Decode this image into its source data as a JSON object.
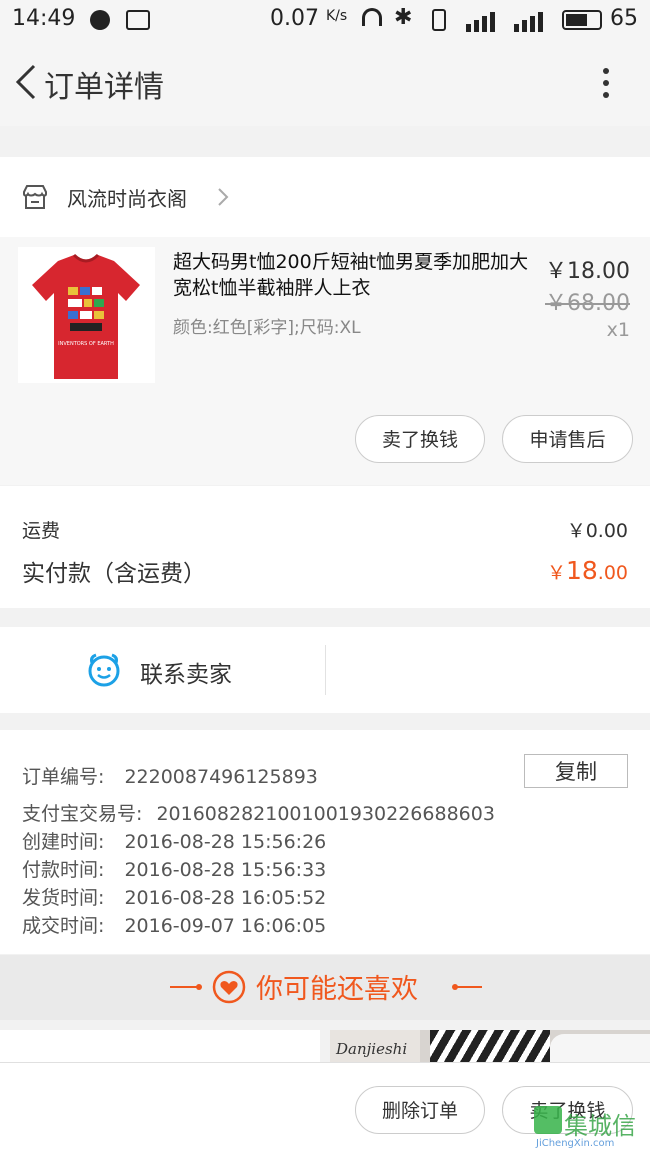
{
  "status_bar": {
    "time": "14:49",
    "net_speed": "0.07",
    "net_unit": "K/s",
    "battery": "65"
  },
  "app_bar": {
    "title": "订单详情"
  },
  "shop": {
    "name": "风流时尚衣阁"
  },
  "product": {
    "title": "超大码男t恤200斤短袖t恤男夏季加肥加大宽松t恤半截袖胖人上衣",
    "attributes": "颜色:红色[彩字];尺码:XL",
    "price": "￥18.00",
    "original_price": "￥68.00",
    "quantity": "x1",
    "image_caption": "INVENTORS OF EARTH"
  },
  "actions": {
    "sell": "卖了换钱",
    "after_sales": "申请售后"
  },
  "fees": {
    "shipping_label": "运费",
    "shipping_value": "￥0.00",
    "paid_label": "实付款（含运费）",
    "paid_symbol": "￥",
    "paid_int": "18",
    "paid_dec": ".00"
  },
  "contact": {
    "label": "联系卖家"
  },
  "order_info": {
    "order_no_label": "订单编号:",
    "order_no": "2220087496125893",
    "copy_label": "复制",
    "alipay_label": "支付宝交易号:",
    "alipay_no": "2016082821001001930226688603",
    "created_label": "创建时间:",
    "created": "2016-08-28 15:56:26",
    "paid_label": "付款时间:",
    "paid": "2016-08-28 15:56:33",
    "shipped_label": "发货时间:",
    "shipped": "2016-08-28 16:05:52",
    "done_label": "成交时间:",
    "done": "2016-09-07 16:06:05"
  },
  "recommend": {
    "title": "你可能还喜欢",
    "thumb_brand": "Danjieshi"
  },
  "bottom_bar": {
    "delete": "删除订单",
    "sell": "卖了换钱"
  },
  "watermark": {
    "brand": "集城信",
    "url": "JiChengXin.com"
  },
  "colors": {
    "accent": "#f0581e",
    "blue": "#1ca1e6",
    "text": "#333333"
  }
}
